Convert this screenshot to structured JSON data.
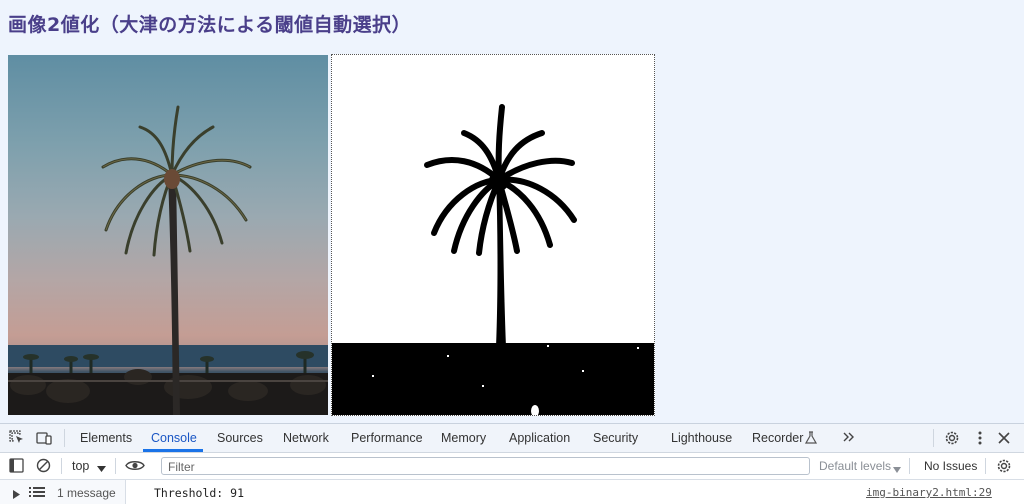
{
  "page": {
    "title": "画像2値化（大津の方法による閾値自動選択）"
  },
  "devtools": {
    "tabs": [
      "Elements",
      "Console",
      "Sources",
      "Network",
      "Performance",
      "Memory",
      "Application",
      "Security",
      "Lighthouse",
      "Recorder"
    ],
    "more_tabs_icon": "chevron-double-right-icon",
    "toolbar": {
      "context": "top",
      "filter_placeholder": "Filter",
      "default_levels": "Default levels",
      "issues": "No Issues"
    },
    "sidebar": {
      "message_count": "1 message"
    },
    "console": {
      "messages": [
        {
          "text": "Threshold: 91",
          "source": "img-binary2.html:29"
        }
      ]
    },
    "accent_color": "#1a73e8"
  }
}
